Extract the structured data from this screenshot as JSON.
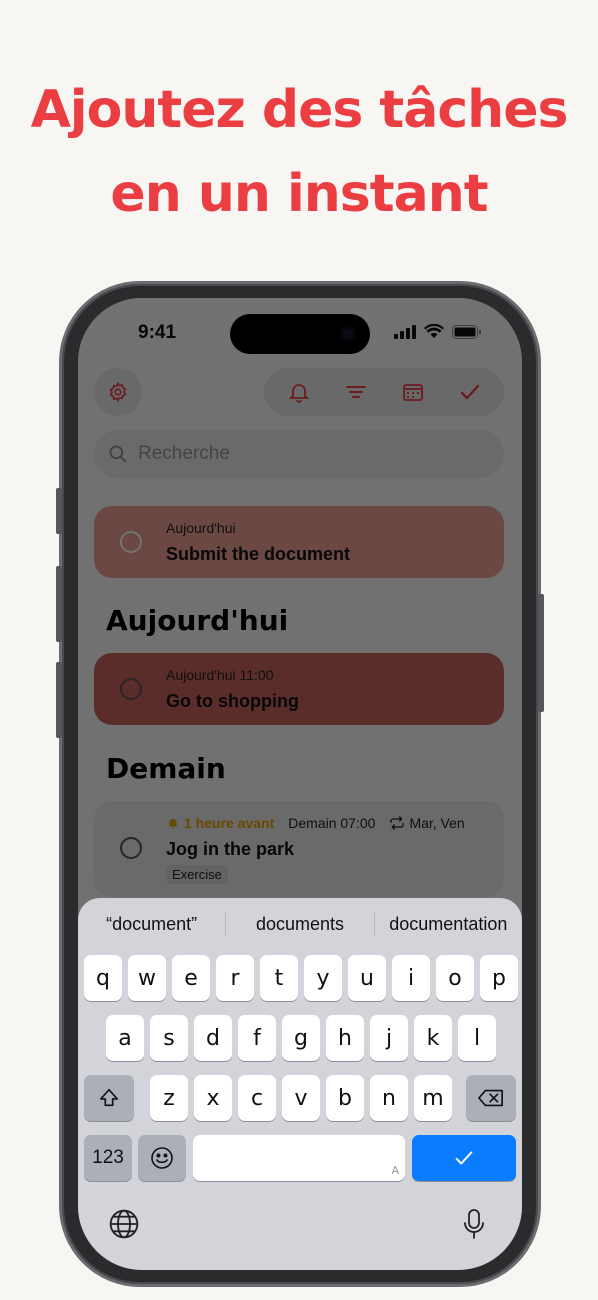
{
  "headline": {
    "line1": "Ajoutez des tâches",
    "line2": "en un instant"
  },
  "status_bar": {
    "time": "9:41"
  },
  "search": {
    "placeholder": "Recherche"
  },
  "pinned_task": {
    "meta": "Aujourd'hui",
    "title": "Submit the document"
  },
  "sections": {
    "today": "Aujourd'hui",
    "tomorrow": "Demain"
  },
  "today_tasks": [
    {
      "meta": "Aujourd'hui 11:00",
      "title": "Go to shopping"
    }
  ],
  "tomorrow_tasks": [
    {
      "reminder": "1 heure avant",
      "due": "Demain 07:00",
      "repeat": "Mar, Ven",
      "title": "Jog in the park",
      "tag": "Exercise"
    }
  ],
  "keyboard": {
    "suggestions": [
      "“document”",
      "documents",
      "documentation"
    ],
    "row1": [
      "q",
      "w",
      "e",
      "r",
      "t",
      "y",
      "u",
      "i",
      "o",
      "p"
    ],
    "row2": [
      "a",
      "s",
      "d",
      "f",
      "g",
      "h",
      "j",
      "k",
      "l"
    ],
    "row3": [
      "z",
      "x",
      "c",
      "v",
      "b",
      "n",
      "m"
    ],
    "numbers_label": "123",
    "space_hint": "A"
  },
  "colors": {
    "brand_red": "#ea3e43",
    "pinned_bg": "#f0a199",
    "today_bg": "#c8645f",
    "card_bg": "#ececec",
    "reminder_orange": "#e8a000",
    "keyboard_blue": "#0a7cff"
  }
}
